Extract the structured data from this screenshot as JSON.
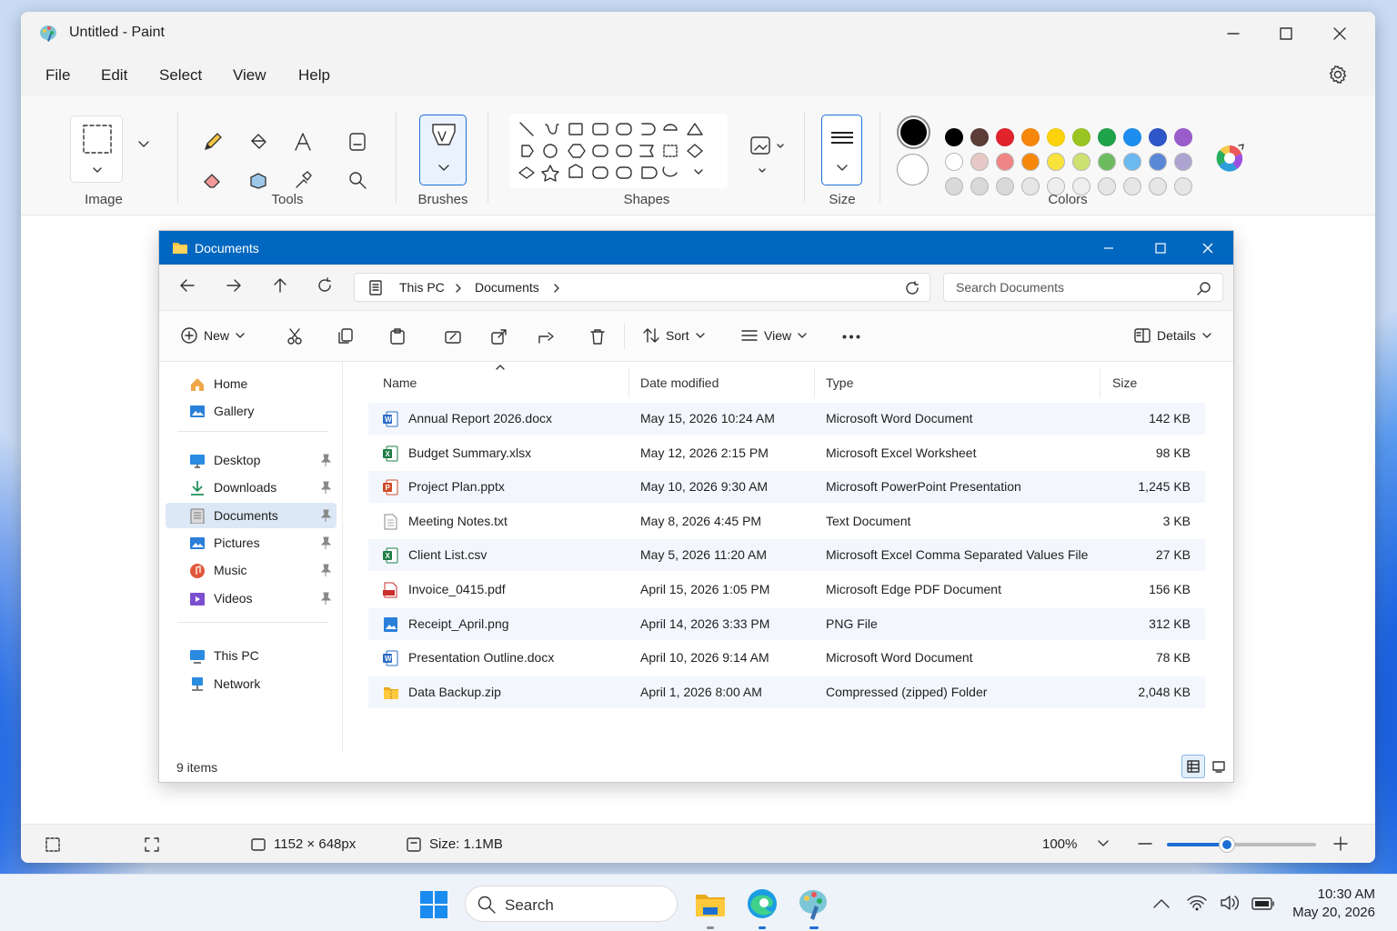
{
  "paint": {
    "title": "Untitled - Paint",
    "menu": [
      "File",
      "Edit",
      "Select",
      "View",
      "Help"
    ],
    "ribbon": {
      "groups": {
        "image": "Image",
        "tools": "Tools",
        "brushes": "Brushes",
        "shapes": "Shapes",
        "size": "Size",
        "colors": "Colors"
      }
    },
    "colors": {
      "primary": "#000000",
      "secondary": "#ffffff",
      "row1": [
        "#000000",
        "#5b3c36",
        "#e1232c",
        "#f7870a",
        "#fcd20b",
        "#9bc522",
        "#1fa34b",
        "#1d8ef0",
        "#2f56c9",
        "#9b5ccb"
      ],
      "row2": [
        "#ffffff",
        "#e6c8c6",
        "#f08586",
        "#f7870a",
        "#fae23c",
        "#cde270",
        "#6dbb5f",
        "#6cb8f0",
        "#5a88d6",
        "#ada4d2"
      ],
      "row3": [
        "#d9d9d9",
        "#d9d9d9",
        "#d9d9d9",
        "#e6e6e6",
        "#eeeeee",
        "#eeeeee",
        "#e6e6e6",
        "#e6e6e6",
        "#e6e6e6",
        "#e6e6e6"
      ]
    },
    "status": {
      "dimensions": "1152 × 648px",
      "size": "Size: 1.1MB",
      "zoom": "100%",
      "zoom_level": 0.4
    }
  },
  "explorer": {
    "title": "Documents",
    "breadcrumb": [
      "This PC",
      "Documents"
    ],
    "search_placeholder": "Search Documents",
    "commands": {
      "new": "New",
      "sort": "Sort",
      "view": "View",
      "details": "Details"
    },
    "sidebar": {
      "group1": [
        {
          "label": "Home",
          "icon": "home-icon"
        },
        {
          "label": "Gallery",
          "icon": "gallery-icon"
        }
      ],
      "group2": [
        {
          "label": "Desktop",
          "icon": "desktop-icon"
        },
        {
          "label": "Downloads",
          "icon": "download-icon"
        },
        {
          "label": "Documents",
          "icon": "documents-icon"
        },
        {
          "label": "Pictures",
          "icon": "pictures-icon"
        },
        {
          "label": "Music",
          "icon": "music-icon"
        },
        {
          "label": "Videos",
          "icon": "videos-icon"
        }
      ],
      "group3": [
        {
          "label": "This PC",
          "icon": "pc-icon"
        },
        {
          "label": "Network",
          "icon": "network-icon"
        }
      ]
    },
    "columns": {
      "name": "Name",
      "date": "Date modified",
      "type": "Type",
      "size": "Size"
    },
    "files": [
      {
        "name": "Annual Report 2026.docx",
        "date": "May 15, 2026 10:24 AM",
        "type": "Microsoft Word Document",
        "size": "142 KB",
        "icon": "word-icon"
      },
      {
        "name": "Budget Summary.xlsx",
        "date": "May 12, 2026 2:15 PM",
        "type": "Microsoft Excel Worksheet",
        "size": "98 KB",
        "icon": "excel-icon"
      },
      {
        "name": "Project Plan.pptx",
        "date": "May 10, 2026 9:30 AM",
        "type": "Microsoft PowerPoint Presentation",
        "size": "1,245 KB",
        "icon": "powerpoint-icon"
      },
      {
        "name": "Meeting Notes.txt",
        "date": "May 8, 2026 4:45 PM",
        "type": "Text Document",
        "size": "3 KB",
        "icon": "text-file-icon"
      },
      {
        "name": "Client List.csv",
        "date": "May 5, 2026 11:20 AM",
        "type": "Microsoft Excel Comma Separated Values File",
        "size": "27 KB",
        "icon": "excel-icon"
      },
      {
        "name": "Invoice_0415.pdf",
        "date": "April 15, 2026 1:05 PM",
        "type": "Microsoft Edge PDF Document",
        "size": "156 KB",
        "icon": "pdf-icon"
      },
      {
        "name": "Receipt_April.png",
        "date": "April 14, 2026 3:33 PM",
        "type": "PNG File",
        "size": "312 KB",
        "icon": "image-file-icon"
      },
      {
        "name": "Presentation Outline.docx",
        "date": "April 10, 2026 9:14 AM",
        "type": "Microsoft Word Document",
        "size": "78 KB",
        "icon": "word-icon"
      },
      {
        "name": "Data Backup.zip",
        "date": "April 1, 2026 8:00 AM",
        "type": "Compressed (zipped) Folder",
        "size": "2,048 KB",
        "icon": "zip-folder-icon"
      }
    ],
    "status": "9 items"
  },
  "taskbar": {
    "search": "Search",
    "time": "10:30 AM",
    "date": "May 20, 2026"
  }
}
